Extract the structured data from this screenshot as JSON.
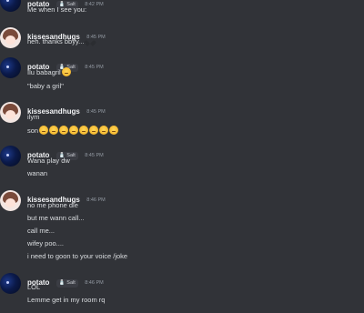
{
  "groups": [
    {
      "user": "potato",
      "tag": "Salt",
      "time": "8:42 PM",
      "messages": [
        "Me when I see you:"
      ]
    },
    {
      "user": "kissesandhugs",
      "time": "8:45 PM",
      "messages": [
        "heh. thanks bbyy...."
      ]
    },
    {
      "user": "potato",
      "tag": "Salt",
      "time": "8:45 PM",
      "messages": [
        "Ilu babagril",
        "\"baby a gril\""
      ]
    },
    {
      "user": "kissesandhugs",
      "time": "8:45 PM",
      "messages": [
        "ilym",
        "son"
      ]
    },
    {
      "user": "potato",
      "tag": "Salt",
      "time": "8:45 PM",
      "messages": [
        "Wana play dw",
        "wanan"
      ]
    },
    {
      "user": "kissesandhugs",
      "time": "8:46 PM",
      "messages": [
        "no me phone die",
        "but me wann call...",
        "call me...",
        "wifey poo....",
        "i need to goon to your voice /joke"
      ]
    },
    {
      "user": "potato",
      "tag": "Salt",
      "time": "8:46 PM",
      "messages": [
        "LOL",
        "Lemme get in my room rq"
      ]
    }
  ],
  "icons": {
    "salt_badge": "salt-shaker-icon",
    "pleading_emoji": "pleading-face-emoji",
    "heart": "black-heart-emoji"
  }
}
